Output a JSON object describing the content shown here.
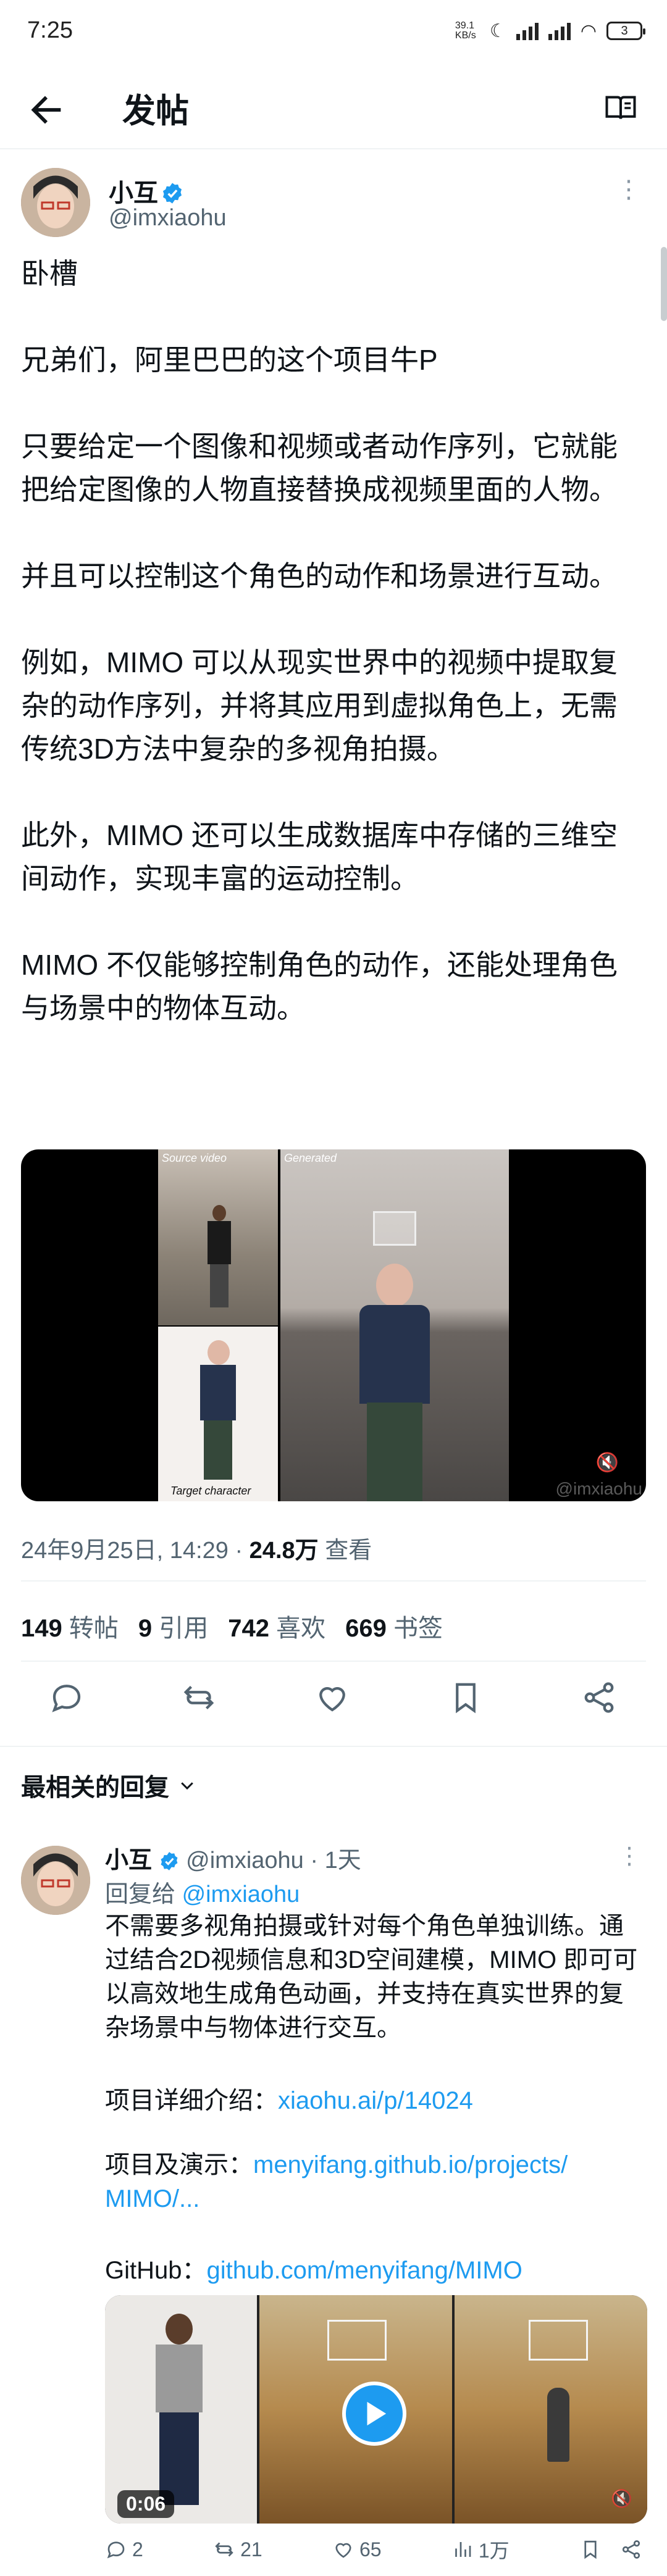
{
  "status_bar": {
    "time": "7:25",
    "net_speed": "39.1 KB/s",
    "battery": "3"
  },
  "nav": {
    "title": "发帖"
  },
  "post": {
    "author_name": "小互",
    "author_handle": "@imxiaohu",
    "text": "卧槽\n\n兄弟们，阿里巴巴的这个项目牛P\n\n只要给定一个图像和视频或者动作序列，它就能把给定图像的人物直接替换成视频里面的人物。\n\n并且可以控制这个角色的动作和场景进行互动。\n\n例如，MIMO 可以从现实世界中的视频中提取复杂的动作序列，并将其应用到虚拟角色上，无需传统3D方法中复杂的多视角拍摄。\n\n此外，MIMO 还可以生成数据库中存储的三维空间动作，实现丰富的运动控制。\n\nMIMO 不仅能够控制角色的动作，还能处理角色与场景中的物体互动。",
    "media": {
      "source_label": "Source video",
      "generated_label": "Generated",
      "target_label": "Target character",
      "watermark": "@imxiaohu"
    },
    "timestamp": "24年9月25日, 14:29",
    "views_count": "24.8万",
    "views_label": "查看",
    "stats": [
      {
        "count": "149",
        "label": "转帖"
      },
      {
        "count": "9",
        "label": "引用"
      },
      {
        "count": "742",
        "label": "喜欢"
      },
      {
        "count": "669",
        "label": "书签"
      }
    ]
  },
  "replies_filter": "最相关的回复",
  "reply": {
    "author_name": "小互",
    "author_handle": "@imxiaohu",
    "time": "· 1天",
    "reply_to_prefix": "回复给",
    "reply_to_handle": "@imxiaohu",
    "text": "不需要多视角拍摄或针对每个角色单独训练。通过结合2D视频信息和3D空间建模，MIMO 即可可以高效地生成角色动画，并支持在真实世界的复杂场景中与物体进行交互。",
    "link1_label": "项目详细介绍：",
    "link1": "xiaohu.ai/p/14024",
    "link2_label": "项目及演示：",
    "link2_line1": "menyifang.github.io/projects/",
    "link2_line2": "MIMO/...",
    "link3_label": "GitHub：",
    "link3": "github.com/menyifang/MIMO",
    "video_duration": "0:06",
    "actions": {
      "replies": "2",
      "reposts": "21",
      "likes": "65",
      "views": "1万"
    }
  },
  "colors": {
    "accent": "#1d9bf0",
    "text": "#0f1419",
    "muted": "#536471"
  }
}
